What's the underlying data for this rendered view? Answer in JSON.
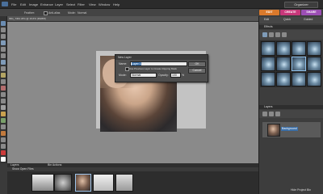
{
  "menubar": {
    "items": [
      "File",
      "Edit",
      "Image",
      "Enhance",
      "Layer",
      "Select",
      "Filter",
      "View",
      "Window",
      "Help"
    ],
    "organizer_label": "Organizer"
  },
  "options": {
    "feather_label": "Feather:",
    "antialias_label": "Anti-alias",
    "mode_label": "Mode:",
    "mode_value": "Normal"
  },
  "mode_tabs": [
    {
      "label": "EDIT",
      "color": "#d9792b"
    },
    {
      "label": "CREATE",
      "color": "#c8377a"
    },
    {
      "label": "SHARE",
      "color": "#9c4fb5"
    }
  ],
  "document": {
    "tab_title": "IMG_7464.JPG @ 16.6% (RGB/8)"
  },
  "dialog": {
    "title": "New Layer",
    "name_label": "Name:",
    "name_value": "Layer 1",
    "group_label": "Use Previous Layer to Create Clipping Mask",
    "mode_label": "Mode:",
    "mode_value": "Normal",
    "opacity_label": "Opacity:",
    "opacity_value": "100",
    "opacity_unit": "%",
    "ok_label": "OK",
    "cancel_label": "Cancel"
  },
  "right_panel": {
    "tabs": [
      "Edit",
      "Quick",
      "Guided"
    ],
    "effects_label": "Effects",
    "layers_label": "Layers",
    "layer_name": "Background"
  },
  "bin": {
    "tabs": [
      "Layers",
      "Bin Actions"
    ],
    "show_label": "Show Open Files",
    "footer_label": "Hide Project Bin"
  },
  "colors": {
    "accent_edit": "#d9792b",
    "accent_create": "#c8377a",
    "accent_share": "#9c4fb5",
    "selection": "#3b6fa8"
  }
}
